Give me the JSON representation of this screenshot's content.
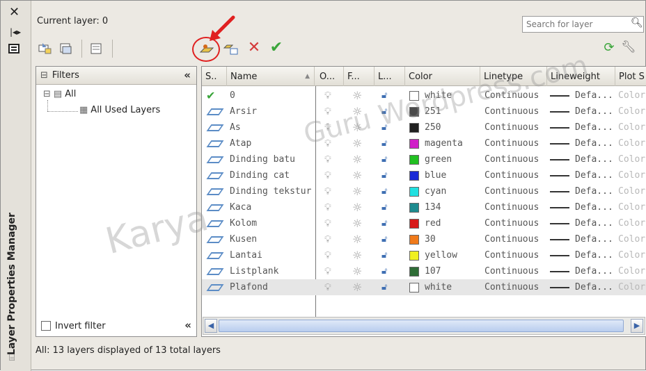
{
  "window": {
    "title": "Layer Properties Manager"
  },
  "header": {
    "current_layer": "Current layer: 0",
    "search_placeholder": "Search for layer"
  },
  "filters": {
    "title": "Filters",
    "tree": [
      {
        "label": "All"
      },
      {
        "label": "All Used Layers"
      }
    ],
    "invert_filter": "Invert filter"
  },
  "table": {
    "columns": [
      "S..",
      "Name",
      "O...",
      "F...",
      "L...",
      "Color",
      "Linetype",
      "Lineweight",
      "Plot S"
    ],
    "rows": [
      {
        "status": "current",
        "name": "0",
        "color_name": "white",
        "color_hex": "#ffffff",
        "linetype": "Continuous",
        "lineweight": "Defa...",
        "plot": "Color"
      },
      {
        "status": "layer",
        "name": "Arsir",
        "color_name": "251",
        "color_hex": "#4a4a4a",
        "linetype": "Continuous",
        "lineweight": "Defa...",
        "plot": "Color"
      },
      {
        "status": "layer",
        "name": "As",
        "color_name": "250",
        "color_hex": "#202020",
        "linetype": "Continuous",
        "lineweight": "Defa...",
        "plot": "Color"
      },
      {
        "status": "layer",
        "name": "Atap",
        "color_name": "magenta",
        "color_hex": "#d020c8",
        "linetype": "Continuous",
        "lineweight": "Defa...",
        "plot": "Color"
      },
      {
        "status": "layer",
        "name": "Dinding batu",
        "color_name": "green",
        "color_hex": "#22c022",
        "linetype": "Continuous",
        "lineweight": "Defa...",
        "plot": "Color"
      },
      {
        "status": "layer",
        "name": "Dinding cat",
        "color_name": "blue",
        "color_hex": "#1a2ad6",
        "linetype": "Continuous",
        "lineweight": "Defa...",
        "plot": "Color"
      },
      {
        "status": "layer",
        "name": "Dinding tekstur",
        "color_name": "cyan",
        "color_hex": "#20e0e0",
        "linetype": "Continuous",
        "lineweight": "Defa...",
        "plot": "Color"
      },
      {
        "status": "layer",
        "name": "Kaca",
        "color_name": "134",
        "color_hex": "#1d8b8f",
        "linetype": "Continuous",
        "lineweight": "Defa...",
        "plot": "Color"
      },
      {
        "status": "layer",
        "name": "Kolom",
        "color_name": "red",
        "color_hex": "#d81a1a",
        "linetype": "Continuous",
        "lineweight": "Defa...",
        "plot": "Color"
      },
      {
        "status": "layer",
        "name": "Kusen",
        "color_name": "30",
        "color_hex": "#f07a1a",
        "linetype": "Continuous",
        "lineweight": "Defa...",
        "plot": "Color"
      },
      {
        "status": "layer",
        "name": "Lantai",
        "color_name": "yellow",
        "color_hex": "#f0f020",
        "linetype": "Continuous",
        "lineweight": "Defa...",
        "plot": "Color"
      },
      {
        "status": "layer",
        "name": "Listplank",
        "color_name": "107",
        "color_hex": "#2e6d36",
        "linetype": "Continuous",
        "lineweight": "Defa...",
        "plot": "Color"
      },
      {
        "status": "layer",
        "name": "Plafond",
        "color_name": "white",
        "color_hex": "#ffffff",
        "linetype": "Continuous",
        "lineweight": "Defa...",
        "plot": "Color",
        "selected": true
      }
    ]
  },
  "status_bar": {
    "text": "All: 13 layers displayed of 13 total layers"
  },
  "watermark": {
    "text_1": "Karya",
    "text_2": "Guru Wordpress.com"
  },
  "accent": {
    "annotation_red": "#e02020"
  }
}
